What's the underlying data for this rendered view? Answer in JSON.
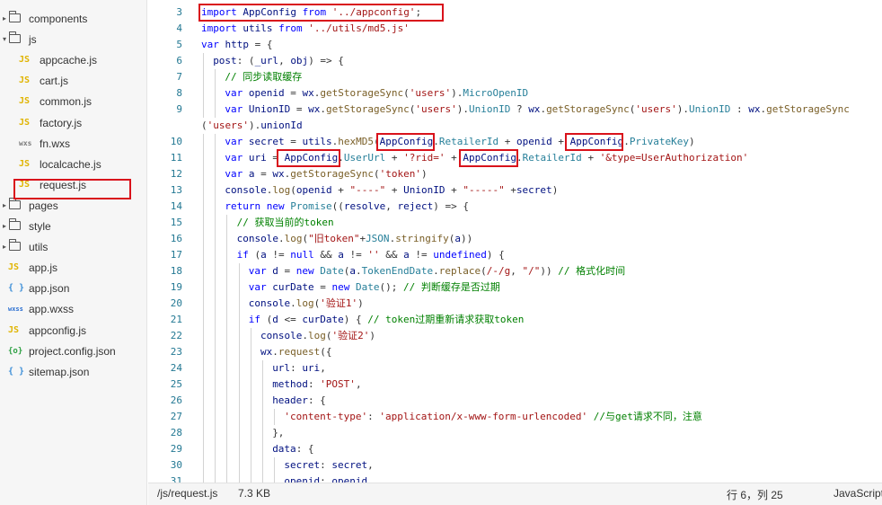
{
  "file_tree": {
    "items": [
      {
        "label": "components",
        "kind": "folder",
        "expanded": false,
        "depth": 0,
        "icon": "folder-icon"
      },
      {
        "label": "js",
        "kind": "folder",
        "expanded": true,
        "depth": 0,
        "icon": "folder-open-icon"
      },
      {
        "label": "appcache.js",
        "kind": "file",
        "depth": 1,
        "icon": "js-file-icon",
        "icon_text": "JS"
      },
      {
        "label": "cart.js",
        "kind": "file",
        "depth": 1,
        "icon": "js-file-icon",
        "icon_text": "JS"
      },
      {
        "label": "common.js",
        "kind": "file",
        "depth": 1,
        "icon": "js-file-icon",
        "icon_text": "JS"
      },
      {
        "label": "factory.js",
        "kind": "file",
        "depth": 1,
        "icon": "js-file-icon",
        "icon_text": "JS"
      },
      {
        "label": "fn.wxs",
        "kind": "file",
        "depth": 1,
        "icon": "wxs-file-icon",
        "icon_text": "wxs"
      },
      {
        "label": "localcache.js",
        "kind": "file",
        "depth": 1,
        "icon": "js-file-icon",
        "icon_text": "JS"
      },
      {
        "label": "request.js",
        "kind": "file",
        "depth": 1,
        "icon": "js-file-icon",
        "icon_text": "JS",
        "selected": true
      },
      {
        "label": "pages",
        "kind": "folder",
        "expanded": false,
        "depth": 0,
        "icon": "folder-icon"
      },
      {
        "label": "style",
        "kind": "folder",
        "expanded": false,
        "depth": 0,
        "icon": "folder-icon"
      },
      {
        "label": "utils",
        "kind": "folder",
        "expanded": false,
        "depth": 0,
        "icon": "folder-icon"
      },
      {
        "label": "app.js",
        "kind": "file",
        "depth": 0,
        "icon": "js-file-icon",
        "icon_text": "JS"
      },
      {
        "label": "app.json",
        "kind": "file",
        "depth": 0,
        "icon": "json-file-icon",
        "icon_text": "{ }"
      },
      {
        "label": "app.wxss",
        "kind": "file",
        "depth": 0,
        "icon": "wxss-file-icon",
        "icon_text": "wxss"
      },
      {
        "label": "appconfig.js",
        "kind": "file",
        "depth": 0,
        "icon": "js-file-icon",
        "icon_text": "JS"
      },
      {
        "label": "project.config.json",
        "kind": "file",
        "depth": 0,
        "icon": "config-file-icon",
        "icon_text": "{o}"
      },
      {
        "label": "sitemap.json",
        "kind": "file",
        "depth": 0,
        "icon": "json-file-icon",
        "icon_text": "{ }"
      }
    ]
  },
  "editor": {
    "lines": [
      {
        "n": "3",
        "indent": 0,
        "t": [
          [
            "kw",
            "import "
          ],
          [
            "id",
            "AppConfig "
          ],
          [
            "kw",
            "from "
          ],
          [
            "str",
            "'../appconfig'"
          ],
          [
            "pl",
            ";"
          ]
        ]
      },
      {
        "n": "4",
        "indent": 0,
        "t": [
          [
            "kw",
            "import "
          ],
          [
            "id",
            "utils "
          ],
          [
            "kw",
            "from "
          ],
          [
            "str",
            "'../utils/md5.js'"
          ]
        ]
      },
      {
        "n": "5",
        "indent": 0,
        "t": [
          [
            "kw",
            "var "
          ],
          [
            "id",
            "http "
          ],
          [
            "pl",
            "= {"
          ]
        ]
      },
      {
        "n": "6",
        "indent": 1,
        "t": [
          [
            "id",
            "post"
          ],
          [
            "pl",
            ": ("
          ],
          [
            "id",
            "_url"
          ],
          [
            "pl",
            ", "
          ],
          [
            "id",
            "obj"
          ],
          [
            "pl",
            ") => {"
          ]
        ]
      },
      {
        "n": "7",
        "indent": 2,
        "t": [
          [
            "cm",
            "// 同步读取缓存"
          ]
        ]
      },
      {
        "n": "8",
        "indent": 2,
        "t": [
          [
            "kw",
            "var "
          ],
          [
            "id",
            "openid "
          ],
          [
            "pl",
            "= "
          ],
          [
            "id",
            "wx"
          ],
          [
            "pl",
            "."
          ],
          [
            "fn",
            "getStorageSync"
          ],
          [
            "pl",
            "("
          ],
          [
            "str",
            "'users'"
          ],
          [
            "pl",
            ")."
          ],
          [
            "ty",
            "MicroOpenID"
          ]
        ]
      },
      {
        "n": "9",
        "indent": 2,
        "t": [
          [
            "kw",
            "var "
          ],
          [
            "id",
            "UnionID "
          ],
          [
            "pl",
            "= "
          ],
          [
            "id",
            "wx"
          ],
          [
            "pl",
            "."
          ],
          [
            "fn",
            "getStorageSync"
          ],
          [
            "pl",
            "("
          ],
          [
            "str",
            "'users'"
          ],
          [
            "pl",
            ")."
          ],
          [
            "ty",
            "UnionID "
          ],
          [
            "pl",
            "? "
          ],
          [
            "id",
            "wx"
          ],
          [
            "pl",
            "."
          ],
          [
            "fn",
            "getStorageSync"
          ],
          [
            "pl",
            "("
          ],
          [
            "str",
            "'users'"
          ],
          [
            "pl",
            ")."
          ],
          [
            "ty",
            "UnionID "
          ],
          [
            "pl",
            ": "
          ],
          [
            "id",
            "wx"
          ],
          [
            "pl",
            "."
          ],
          [
            "fn",
            "getStorageSync"
          ]
        ]
      },
      {
        "n": "",
        "indent": -1,
        "t": [
          [
            "pl",
            "("
          ],
          [
            "str",
            "'users'"
          ],
          [
            "pl",
            ")."
          ],
          [
            "id",
            "unionId"
          ]
        ]
      },
      {
        "n": "10",
        "indent": 2,
        "t": [
          [
            "kw",
            "var "
          ],
          [
            "id",
            "secret "
          ],
          [
            "pl",
            "= "
          ],
          [
            "id",
            "utils"
          ],
          [
            "pl",
            "."
          ],
          [
            "fn",
            "hexMD5"
          ],
          [
            "pl",
            "("
          ],
          [
            "id",
            "AppConfig"
          ],
          [
            "pl",
            "."
          ],
          [
            "ty",
            "RetailerId "
          ],
          [
            "pl",
            "+ "
          ],
          [
            "id",
            "openid "
          ],
          [
            "pl",
            "+ "
          ],
          [
            "id",
            "AppConfig"
          ],
          [
            "pl",
            "."
          ],
          [
            "ty",
            "PrivateKey"
          ],
          [
            "pl",
            ")"
          ]
        ]
      },
      {
        "n": "11",
        "indent": 2,
        "t": [
          [
            "kw",
            "var "
          ],
          [
            "id",
            "uri "
          ],
          [
            "pl",
            "= "
          ],
          [
            "id",
            "AppConfig"
          ],
          [
            "pl",
            "."
          ],
          [
            "ty",
            "UserUrl "
          ],
          [
            "pl",
            "+ "
          ],
          [
            "str",
            "'?rid=' "
          ],
          [
            "pl",
            "+ "
          ],
          [
            "id",
            "AppConfig"
          ],
          [
            "pl",
            "."
          ],
          [
            "ty",
            "RetailerId "
          ],
          [
            "pl",
            "+ "
          ],
          [
            "str",
            "'&type=UserAuthorization'"
          ]
        ]
      },
      {
        "n": "12",
        "indent": 2,
        "t": [
          [
            "kw",
            "var "
          ],
          [
            "id",
            "a "
          ],
          [
            "pl",
            "= "
          ],
          [
            "id",
            "wx"
          ],
          [
            "pl",
            "."
          ],
          [
            "fn",
            "getStorageSync"
          ],
          [
            "pl",
            "("
          ],
          [
            "str",
            "'token'"
          ],
          [
            "pl",
            ")"
          ]
        ]
      },
      {
        "n": "13",
        "indent": 2,
        "t": [
          [
            "id",
            "console"
          ],
          [
            "pl",
            "."
          ],
          [
            "fn",
            "log"
          ],
          [
            "pl",
            "("
          ],
          [
            "id",
            "openid "
          ],
          [
            "pl",
            "+ "
          ],
          [
            "str",
            "\"----\" "
          ],
          [
            "pl",
            "+ "
          ],
          [
            "id",
            "UnionID "
          ],
          [
            "pl",
            "+ "
          ],
          [
            "str",
            "\"-----\" "
          ],
          [
            "pl",
            "+"
          ],
          [
            "id",
            "secret"
          ],
          [
            "pl",
            ")"
          ]
        ]
      },
      {
        "n": "14",
        "indent": 2,
        "t": [
          [
            "kw",
            "return new "
          ],
          [
            "ty",
            "Promise"
          ],
          [
            "pl",
            "(("
          ],
          [
            "id",
            "resolve"
          ],
          [
            "pl",
            ", "
          ],
          [
            "id",
            "reject"
          ],
          [
            "pl",
            ") => {"
          ]
        ]
      },
      {
        "n": "15",
        "indent": 3,
        "t": [
          [
            "cm",
            "// 获取当前的token"
          ]
        ]
      },
      {
        "n": "16",
        "indent": 3,
        "t": [
          [
            "id",
            "console"
          ],
          [
            "pl",
            "."
          ],
          [
            "fn",
            "log"
          ],
          [
            "pl",
            "("
          ],
          [
            "str",
            "\"旧token\""
          ],
          [
            "pl",
            "+"
          ],
          [
            "ty",
            "JSON"
          ],
          [
            "pl",
            "."
          ],
          [
            "fn",
            "stringify"
          ],
          [
            "pl",
            "("
          ],
          [
            "id",
            "a"
          ],
          [
            "pl",
            "))"
          ]
        ]
      },
      {
        "n": "17",
        "indent": 3,
        "t": [
          [
            "kw",
            "if "
          ],
          [
            "pl",
            "("
          ],
          [
            "id",
            "a "
          ],
          [
            "pl",
            "!= "
          ],
          [
            "kw",
            "null "
          ],
          [
            "pl",
            "&& "
          ],
          [
            "id",
            "a "
          ],
          [
            "pl",
            "!= "
          ],
          [
            "str",
            "'' "
          ],
          [
            "pl",
            "&& "
          ],
          [
            "id",
            "a "
          ],
          [
            "pl",
            "!= "
          ],
          [
            "kw",
            "undefined"
          ],
          [
            "pl",
            ") {"
          ]
        ]
      },
      {
        "n": "18",
        "indent": 4,
        "t": [
          [
            "kw",
            "var "
          ],
          [
            "id",
            "d "
          ],
          [
            "pl",
            "= "
          ],
          [
            "kw",
            "new "
          ],
          [
            "ty",
            "Date"
          ],
          [
            "pl",
            "("
          ],
          [
            "id",
            "a"
          ],
          [
            "pl",
            "."
          ],
          [
            "ty",
            "TokenEndDate"
          ],
          [
            "pl",
            "."
          ],
          [
            "fn",
            "replace"
          ],
          [
            "pl",
            "("
          ],
          [
            "str",
            "/-/g"
          ],
          [
            "pl",
            ", "
          ],
          [
            "str",
            "\"/\""
          ],
          [
            "pl",
            "))"
          ],
          [
            "cm",
            " // 格式化时间"
          ]
        ]
      },
      {
        "n": "19",
        "indent": 4,
        "t": [
          [
            "kw",
            "var "
          ],
          [
            "id",
            "curDate "
          ],
          [
            "pl",
            "= "
          ],
          [
            "kw",
            "new "
          ],
          [
            "ty",
            "Date"
          ],
          [
            "pl",
            "();"
          ],
          [
            "cm",
            " // 判断缓存是否过期"
          ]
        ]
      },
      {
        "n": "20",
        "indent": 4,
        "t": [
          [
            "id",
            "console"
          ],
          [
            "pl",
            "."
          ],
          [
            "fn",
            "log"
          ],
          [
            "pl",
            "("
          ],
          [
            "str",
            "'验证1'"
          ],
          [
            "pl",
            ")"
          ]
        ]
      },
      {
        "n": "21",
        "indent": 4,
        "t": [
          [
            "kw",
            "if "
          ],
          [
            "pl",
            "("
          ],
          [
            "id",
            "d "
          ],
          [
            "pl",
            "<= "
          ],
          [
            "id",
            "curDate"
          ],
          [
            "pl",
            ") {"
          ],
          [
            "cm",
            " // token过期重新请求获取token"
          ]
        ]
      },
      {
        "n": "22",
        "indent": 5,
        "t": [
          [
            "id",
            "console"
          ],
          [
            "pl",
            "."
          ],
          [
            "fn",
            "log"
          ],
          [
            "pl",
            "("
          ],
          [
            "str",
            "'验证2'"
          ],
          [
            "pl",
            ")"
          ]
        ]
      },
      {
        "n": "23",
        "indent": 5,
        "t": [
          [
            "id",
            "wx"
          ],
          [
            "pl",
            "."
          ],
          [
            "fn",
            "request"
          ],
          [
            "pl",
            "({"
          ]
        ]
      },
      {
        "n": "24",
        "indent": 6,
        "t": [
          [
            "id",
            "url"
          ],
          [
            "pl",
            ": "
          ],
          [
            "id",
            "uri"
          ],
          [
            "pl",
            ","
          ]
        ]
      },
      {
        "n": "25",
        "indent": 6,
        "t": [
          [
            "id",
            "method"
          ],
          [
            "pl",
            ": "
          ],
          [
            "str",
            "'POST'"
          ],
          [
            "pl",
            ","
          ]
        ]
      },
      {
        "n": "26",
        "indent": 6,
        "t": [
          [
            "id",
            "header"
          ],
          [
            "pl",
            ": {"
          ]
        ]
      },
      {
        "n": "27",
        "indent": 7,
        "t": [
          [
            "str",
            "'content-type'"
          ],
          [
            "pl",
            ": "
          ],
          [
            "str",
            "'application/x-www-form-urlencoded'"
          ],
          [
            "cm",
            " //与get请求不同，注意"
          ]
        ]
      },
      {
        "n": "28",
        "indent": 6,
        "t": [
          [
            "pl",
            "},"
          ]
        ]
      },
      {
        "n": "29",
        "indent": 6,
        "t": [
          [
            "id",
            "data"
          ],
          [
            "pl",
            ": {"
          ]
        ]
      },
      {
        "n": "30",
        "indent": 7,
        "t": [
          [
            "id",
            "secret"
          ],
          [
            "pl",
            ": "
          ],
          [
            "id",
            "secret"
          ],
          [
            "pl",
            ","
          ]
        ]
      },
      {
        "n": "31",
        "indent": 7,
        "t": [
          [
            "id",
            "openid"
          ],
          [
            "pl",
            ": "
          ],
          [
            "id",
            "openid"
          ]
        ]
      }
    ]
  },
  "status_bar": {
    "path": "/js/request.js",
    "size": "7.3 KB",
    "position": "行 6，列 25",
    "language": "JavaScript"
  },
  "colors": {
    "keyword": "#0000ff",
    "identifier": "#001080",
    "string": "#a31515",
    "comment": "#008000",
    "function": "#795e26",
    "type": "#267f99",
    "line_number": "#237893",
    "js_icon": "#e0b400",
    "json_icon": "#3f90d8",
    "highlight_box": "#d9121b"
  }
}
